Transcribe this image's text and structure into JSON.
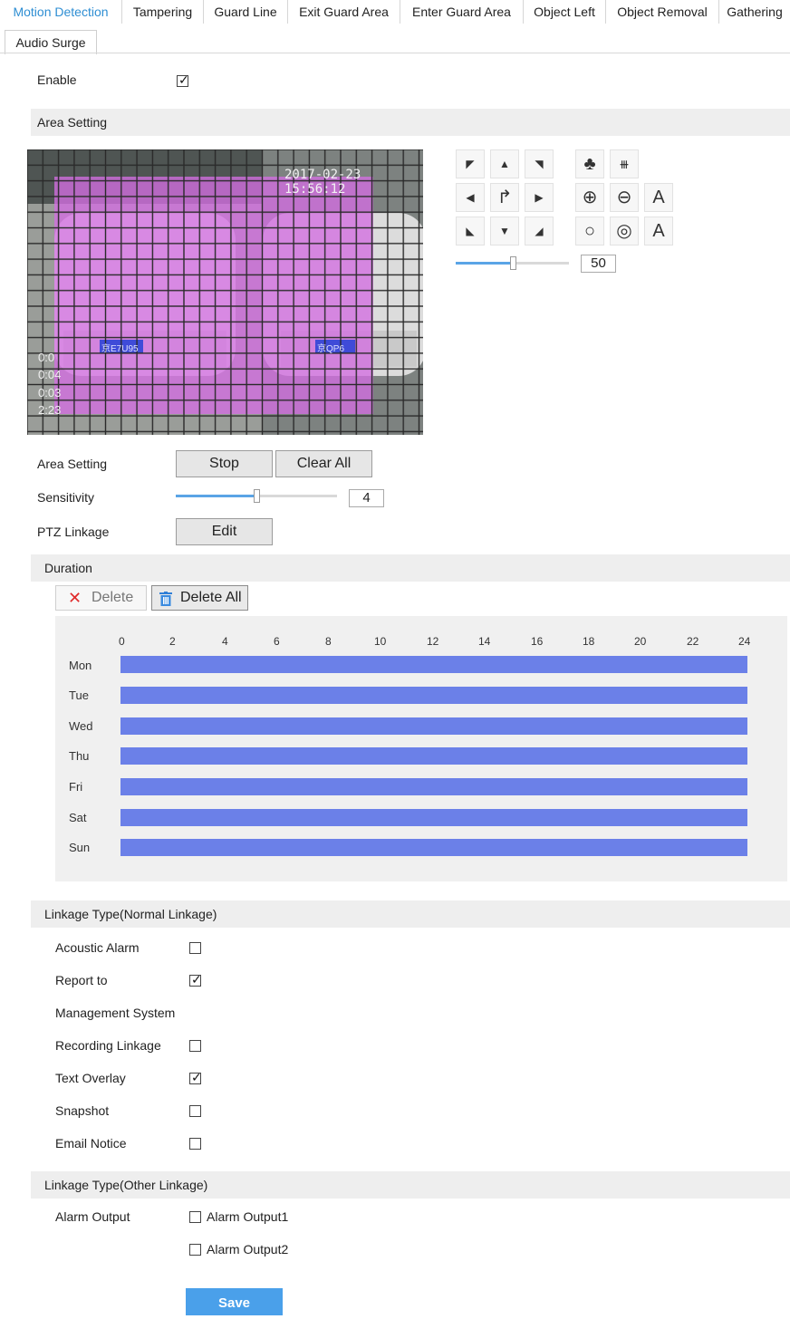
{
  "tabs": {
    "row1": [
      "Motion Detection",
      "Tampering",
      "Guard Line",
      "Exit Guard Area",
      "Enter Guard Area",
      "Object Left",
      "Object Removal",
      "Gathering"
    ],
    "row2": [
      "Audio Surge"
    ],
    "active": "Motion Detection"
  },
  "enable": {
    "label": "Enable",
    "checked": true
  },
  "area_setting_header": "Area Setting",
  "video": {
    "timestamp": "2017-02-23 15:56:12",
    "plates": [
      "京E7U95",
      "京QP6"
    ],
    "overlay_lines": [
      "0:0",
      "0:04",
      "0:03",
      "2:23"
    ]
  },
  "ptz": {
    "zoom_value": "50",
    "letter_a": "A",
    "letter_a2": "A"
  },
  "form": {
    "area_setting_label": "Area Setting",
    "stop_label": "Stop",
    "clear_all_label": "Clear All",
    "sensitivity_label": "Sensitivity",
    "sensitivity_value": "4",
    "ptz_linkage_label": "PTZ Linkage",
    "edit_label": "Edit"
  },
  "duration": {
    "header": "Duration",
    "delete_label": "Delete",
    "delete_all_label": "Delete All",
    "hours": [
      "0",
      "2",
      "4",
      "6",
      "8",
      "10",
      "12",
      "14",
      "16",
      "18",
      "20",
      "22",
      "24"
    ],
    "days": [
      "Mon",
      "Tue",
      "Wed",
      "Thu",
      "Fri",
      "Sat",
      "Sun"
    ]
  },
  "normal_linkage": {
    "header": "Linkage Type(Normal Linkage)",
    "acoustic_alarm": "Acoustic Alarm",
    "report_to": "Report to",
    "management_system": "Management System",
    "recording_linkage": "Recording Linkage",
    "text_overlay": "Text Overlay",
    "snapshot": "Snapshot",
    "email_notice": "Email Notice"
  },
  "other_linkage": {
    "header": "Linkage Type(Other Linkage)",
    "alarm_output_label": "Alarm Output",
    "output1": "Alarm Output1",
    "output2": "Alarm Output2"
  },
  "save_label": "Save",
  "colors": {
    "accent": "#2e8ed3",
    "schedule_bar": "#6b80e8",
    "save_button": "#4aa0ea",
    "mask": "#d070e0"
  }
}
